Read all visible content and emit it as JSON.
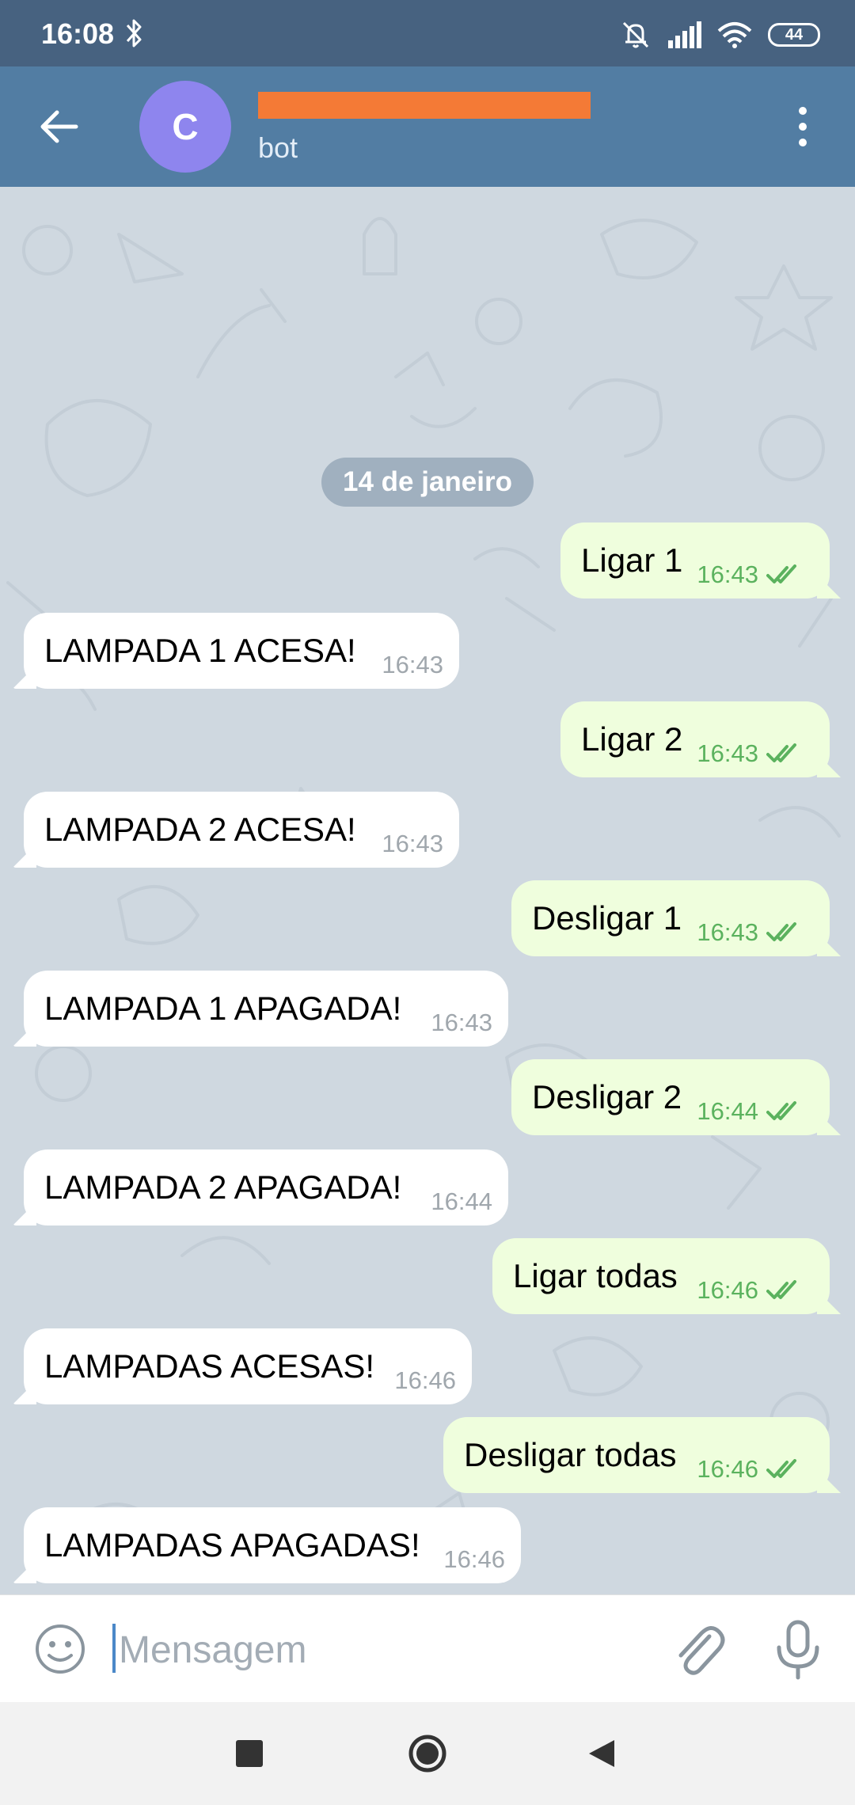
{
  "status_bar": {
    "time": "16:08",
    "battery": "44",
    "icons": [
      "bluetooth-icon",
      "mute-icon",
      "signal-icon",
      "wifi-icon",
      "battery-icon"
    ]
  },
  "header": {
    "avatar_letter": "C",
    "title_redacted": true,
    "subtitle": "bot",
    "colors": {
      "bar": "#527da3",
      "avatar": "#8e85ee",
      "redaction": "#f47a36"
    }
  },
  "chat": {
    "date_divider": "14 de janeiro",
    "messages": [
      {
        "dir": "out",
        "text": "Ligar 1",
        "time": "16:43"
      },
      {
        "dir": "in",
        "text": "LAMPADA 1 ACESA!",
        "time": "16:43"
      },
      {
        "dir": "out",
        "text": "Ligar 2",
        "time": "16:43"
      },
      {
        "dir": "in",
        "text": "LAMPADA 2 ACESA!",
        "time": "16:43"
      },
      {
        "dir": "out",
        "text": "Desligar 1",
        "time": "16:43"
      },
      {
        "dir": "in",
        "text": "LAMPADA 1 APAGADA!",
        "time": "16:43"
      },
      {
        "dir": "out",
        "text": "Desligar 2",
        "time": "16:44"
      },
      {
        "dir": "in",
        "text": "LAMPADA 2 APAGADA!",
        "time": "16:44"
      },
      {
        "dir": "out",
        "text": "Ligar todas",
        "time": "16:46"
      },
      {
        "dir": "in",
        "text": "LAMPADAS ACESAS!",
        "time": "16:46"
      },
      {
        "dir": "out",
        "text": "Desligar todas",
        "time": "16:46"
      },
      {
        "dir": "in",
        "text": "LAMPADAS APAGADAS!",
        "time": "16:46"
      }
    ],
    "colors": {
      "incoming": "#ffffff",
      "outgoing": "#effedd",
      "read_check": "#5bb25e"
    }
  },
  "input_bar": {
    "placeholder": "Mensagem",
    "value": ""
  }
}
